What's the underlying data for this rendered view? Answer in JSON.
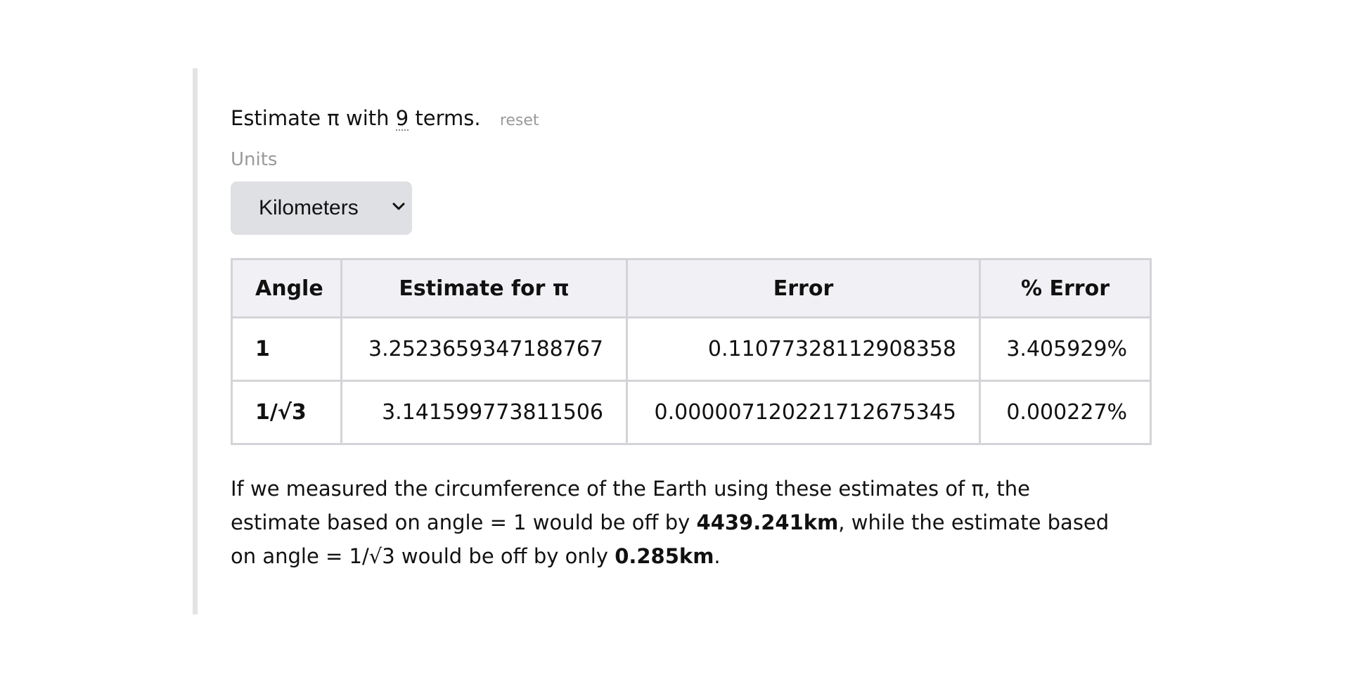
{
  "estimate": {
    "prefix": "Estimate π with",
    "terms": "9",
    "suffix": "terms.",
    "reset_label": "reset"
  },
  "units": {
    "label": "Units",
    "selected": "Kilometers",
    "chevron_icon": "chevron-down-icon"
  },
  "table": {
    "headers": [
      "Angle",
      "Estimate for π",
      "Error",
      "% Error"
    ],
    "rows": [
      {
        "angle": "1",
        "estimate": "3.2523659347188767",
        "error": "0.11077328112908358",
        "percent_error": "3.405929%"
      },
      {
        "angle": "1/√3",
        "estimate": "3.141599773811506",
        "error": "0.0000071202217126753​45",
        "percent_error": "0.000227%"
      }
    ]
  },
  "summary": {
    "part1": "If we measured the circumference of the Earth using these estimates of π, the estimate based on angle = 1 would be off by",
    "value1": "4439.241km",
    "part2": ", while the estimate based on angle = 1/√3 would be off by only",
    "value2": "0.285km",
    "part3": "."
  },
  "colors": {
    "quote_bar": "#e3e3e6",
    "select_bg": "#dfe0e4",
    "header_bg": "#f1f1f5",
    "border": "#d4d4d8",
    "muted_text": "#9a9a9a"
  }
}
